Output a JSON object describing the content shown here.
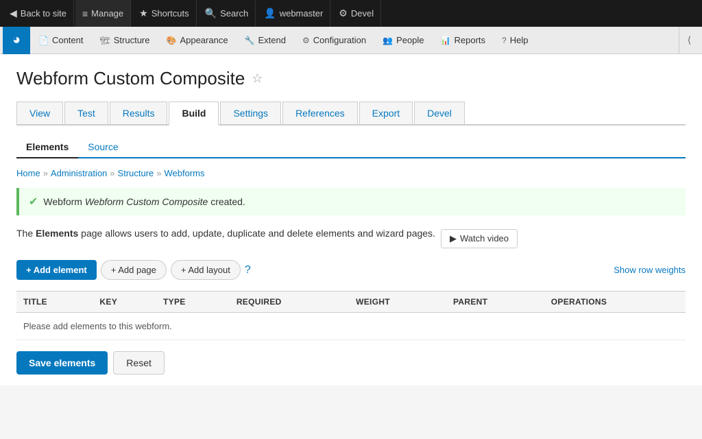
{
  "adminBar": {
    "items": [
      {
        "id": "back-to-site",
        "label": "Back to site",
        "icon": "◀"
      },
      {
        "id": "manage",
        "label": "Manage",
        "icon": "≡"
      },
      {
        "id": "shortcuts",
        "label": "Shortcuts",
        "icon": "★"
      },
      {
        "id": "search",
        "label": "Search",
        "icon": "🔍"
      },
      {
        "id": "webmaster",
        "label": "webmaster",
        "icon": "👤"
      },
      {
        "id": "devel",
        "label": "Devel",
        "icon": "⚙"
      }
    ]
  },
  "secondaryNav": {
    "items": [
      {
        "id": "content",
        "label": "Content",
        "icon": "📄"
      },
      {
        "id": "structure",
        "label": "Structure",
        "icon": "🏗"
      },
      {
        "id": "appearance",
        "label": "Appearance",
        "icon": "🎨"
      },
      {
        "id": "extend",
        "label": "Extend",
        "icon": "🔧"
      },
      {
        "id": "configuration",
        "label": "Configuration",
        "icon": "⚙"
      },
      {
        "id": "people",
        "label": "People",
        "icon": "👥"
      },
      {
        "id": "reports",
        "label": "Reports",
        "icon": "📊"
      },
      {
        "id": "help",
        "label": "Help",
        "icon": "?"
      }
    ]
  },
  "page": {
    "title": "Webform Custom Composite",
    "tabs": [
      {
        "id": "view",
        "label": "View"
      },
      {
        "id": "test",
        "label": "Test"
      },
      {
        "id": "results",
        "label": "Results"
      },
      {
        "id": "build",
        "label": "Build",
        "active": true
      },
      {
        "id": "settings",
        "label": "Settings"
      },
      {
        "id": "references",
        "label": "References"
      },
      {
        "id": "export",
        "label": "Export"
      },
      {
        "id": "devel",
        "label": "Devel"
      }
    ],
    "subTabs": [
      {
        "id": "elements",
        "label": "Elements",
        "active": true
      },
      {
        "id": "source",
        "label": "Source"
      }
    ]
  },
  "breadcrumb": {
    "items": [
      {
        "label": "Home",
        "href": "#"
      },
      {
        "label": "Administration",
        "href": "#"
      },
      {
        "label": "Structure",
        "href": "#"
      },
      {
        "label": "Webforms",
        "href": "#"
      }
    ]
  },
  "messages": {
    "success": {
      "text_before": "Webform ",
      "em": "Webform Custom Composite",
      "text_after": " created."
    }
  },
  "description": {
    "text_before": "The ",
    "strong": "Elements",
    "text_after": " page allows users to add, update, duplicate and delete elements and wizard pages."
  },
  "buttons": {
    "watch_video": "▶ Watch video",
    "add_element": "+ Add element",
    "add_page": "+ Add page",
    "add_layout": "+ Add layout",
    "show_row_weights": "Show row weights",
    "save_elements": "Save elements",
    "reset": "Reset"
  },
  "table": {
    "headers": [
      "TITLE",
      "KEY",
      "TYPE",
      "REQUIRED",
      "WEIGHT",
      "PARENT",
      "OPERATIONS"
    ],
    "empty_message": "Please add elements to this webform.",
    "rows": []
  },
  "colors": {
    "primary": "#0678be",
    "admin_bar_bg": "#1a1a1a",
    "secondary_nav_bg": "#ebebeb",
    "success_border": "#5cb85c",
    "success_bg": "#f0fff0"
  }
}
